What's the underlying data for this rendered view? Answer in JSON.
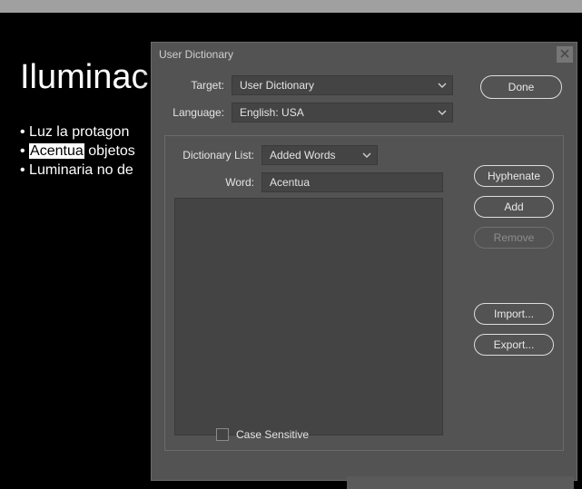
{
  "document": {
    "title": "Iluminac",
    "bullets": [
      {
        "prefix": "• Luz la protagon",
        "highlight": "",
        "suffix": ""
      },
      {
        "prefix": "• ",
        "highlight": "Acentua",
        "suffix": " objetos"
      },
      {
        "prefix": "• Luminaria no de",
        "highlight": "",
        "suffix": ""
      }
    ]
  },
  "dialog": {
    "title": "User Dictionary",
    "close_icon": "x",
    "labels": {
      "target": "Target:",
      "language": "Language:",
      "dictionary_list": "Dictionary List:",
      "word": "Word:",
      "case_sensitive": "Case Sensitive"
    },
    "values": {
      "target": "User Dictionary",
      "language": "English: USA",
      "dictionary_list": "Added Words",
      "word": "Acentua",
      "case_sensitive": false
    },
    "buttons": {
      "done": "Done",
      "hyphenate": "Hyphenate",
      "add": "Add",
      "remove": "Remove",
      "import": "Import...",
      "export": "Export..."
    }
  }
}
